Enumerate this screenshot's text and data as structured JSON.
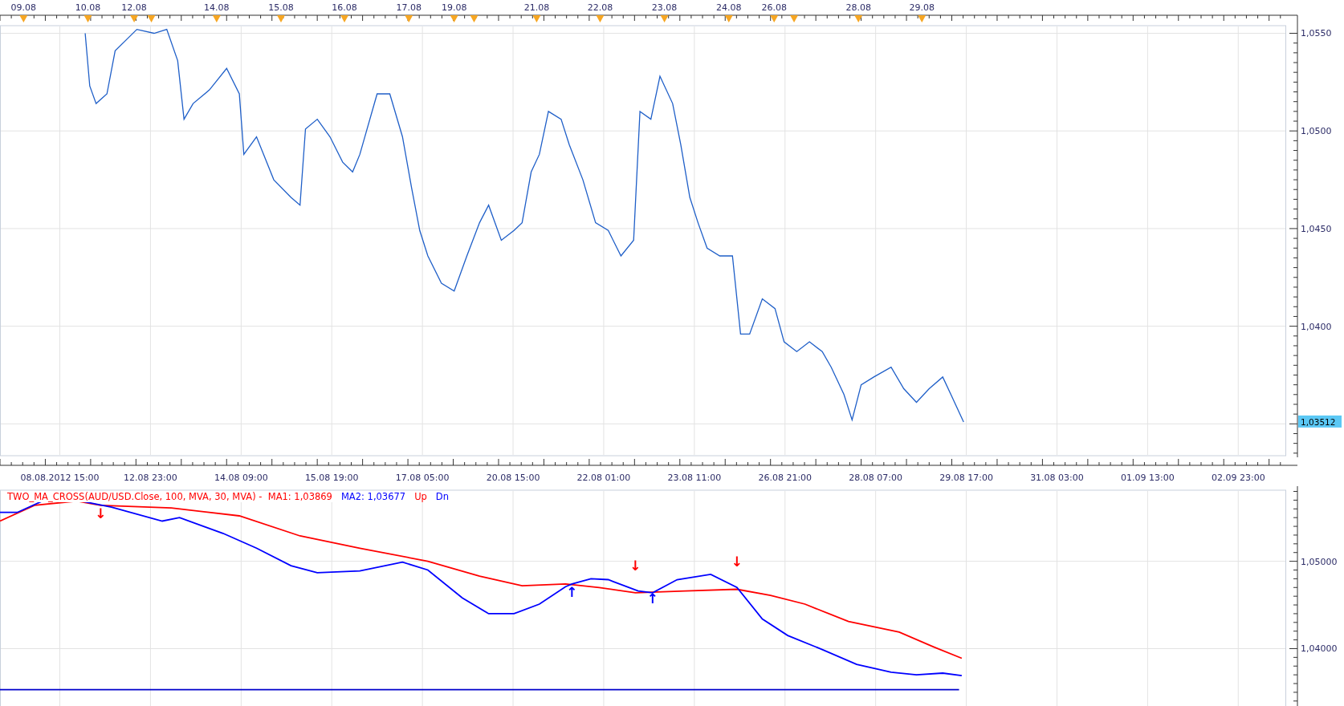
{
  "price_chart": {
    "date_labels": [
      "09.08",
      "10.08",
      "12.08",
      "14.08",
      "15.08",
      "16.08",
      "17.08",
      "19.08",
      "21.08",
      "22.08",
      "23.08",
      "24.08",
      "26.08",
      "28.08",
      "29.08"
    ],
    "price_labels": [
      "1,0550",
      "1,0500",
      "1,0450",
      "1,0400"
    ],
    "last_price": "1,03512"
  },
  "time_axis": {
    "labels": [
      "08.08.2012 15:00",
      "12.08 23:00",
      "14.08 09:00",
      "15.08 19:00",
      "17.08 05:00",
      "20.08 15:00",
      "22.08 01:00",
      "23.08 11:00",
      "26.08 21:00",
      "28.08 07:00",
      "29.08 17:00",
      "31.08 03:00",
      "01.09 13:00",
      "02.09 23:00"
    ]
  },
  "indicator": {
    "legend": [
      {
        "text": "TWO_MA_CROSS(AUD/USD.Close, 100, MVA, 30, MVA) -  MA1: 1,03869",
        "color": "#ff0000"
      },
      {
        "text": "MA2: 1,03677",
        "color": "#0000ff"
      },
      {
        "text": "Up",
        "color": "#ff0000"
      },
      {
        "text": "Dn",
        "color": "#0000ff"
      }
    ],
    "value_labels": [
      "1,05000",
      "1,04000"
    ],
    "signals": [
      {
        "text": "↓",
        "color": "#ff0000"
      },
      {
        "text": "↑",
        "color": "#0000ff"
      },
      {
        "text": "↓",
        "color": "#ff0000"
      },
      {
        "text": "↑",
        "color": "#0000ff"
      },
      {
        "text": "↓",
        "color": "#ff0000"
      }
    ]
  }
}
